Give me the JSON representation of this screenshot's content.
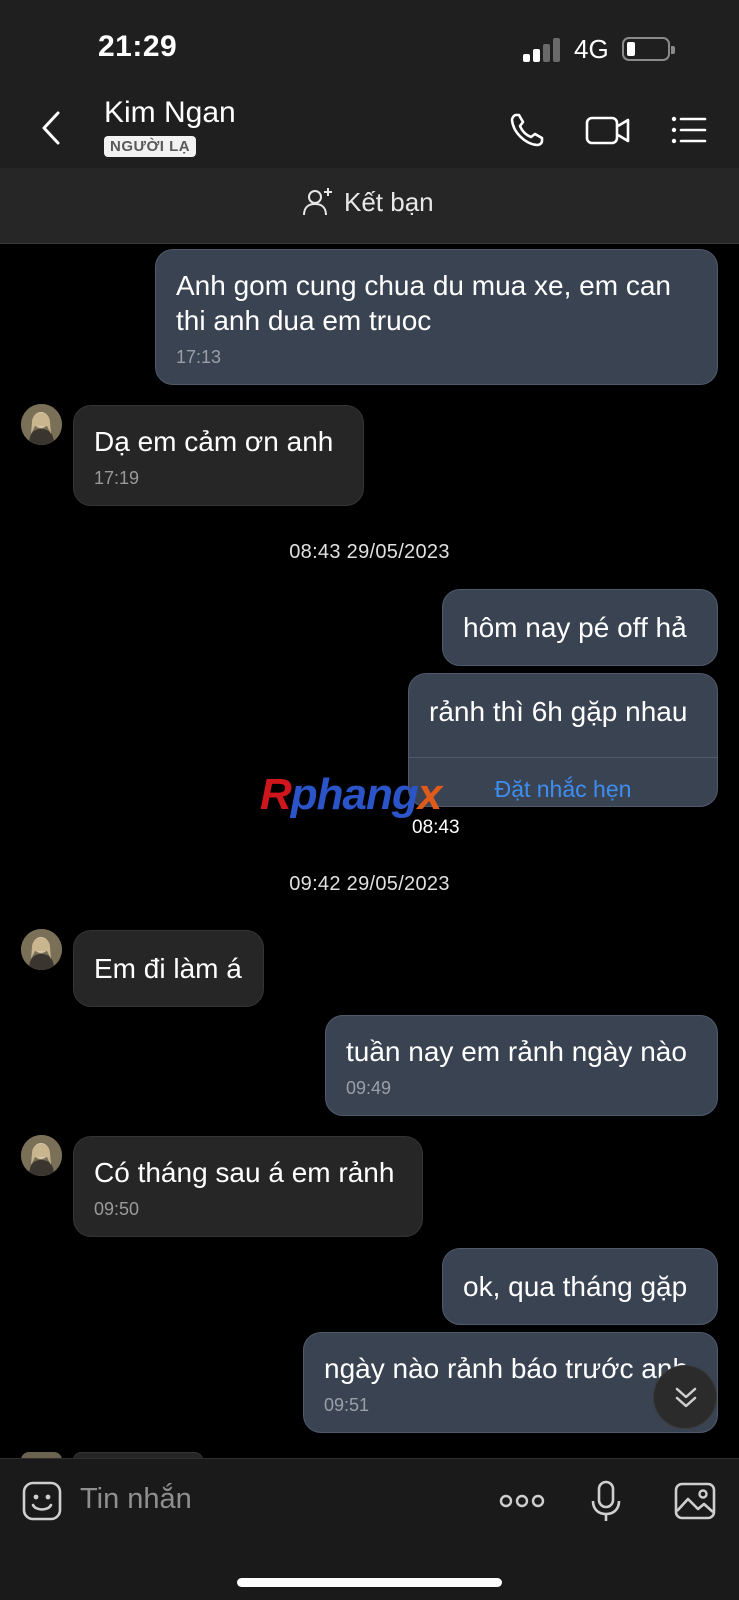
{
  "status_bar": {
    "time": "21:29",
    "network": "4G",
    "battery_level": 0.15
  },
  "header": {
    "contact_name": "Kim Ngan",
    "badge": "NGƯỜI LẠ",
    "icons": [
      "back-icon",
      "phone-icon",
      "video-call-icon",
      "menu-list-icon"
    ]
  },
  "add_friend": {
    "label": "Kết bạn",
    "icon": "add-user-icon"
  },
  "messages": [
    {
      "dir": "out",
      "text": "Anh gom cung chua du mua xe, em can thi anh dua em truoc",
      "time": "17:13"
    },
    {
      "dir": "in",
      "text": "Dạ em cảm ơn anh",
      "time": "17:19"
    },
    {
      "separator": "08:43 29/05/2023"
    },
    {
      "dir": "out",
      "text": "hôm nay pé off hả"
    },
    {
      "dir": "out",
      "text": "rảnh thì 6h gặp nhau",
      "action": "Đặt nhắc hẹn",
      "time": "08:43"
    },
    {
      "separator": "09:42 29/05/2023"
    },
    {
      "dir": "in",
      "text": "Em đi làm á"
    },
    {
      "dir": "out",
      "text": "tuần nay em rảnh ngày nào",
      "time": "09:49"
    },
    {
      "dir": "in",
      "text": "Có tháng sau á em rảnh",
      "time": "09:50"
    },
    {
      "dir": "out",
      "text": "ok, qua tháng gặp"
    },
    {
      "dir": "out",
      "text": "ngày nào rảnh báo trước anh",
      "time": "09:51"
    }
  ],
  "watermark": {
    "part1": "R",
    "part2": "phang",
    "part3": "x"
  },
  "composer": {
    "placeholder": "Tin nhắn",
    "icons": [
      "sticker-icon",
      "more-dots-icon",
      "microphone-icon",
      "image-icon"
    ]
  },
  "colors": {
    "outgoing_bubble": "#3a4352",
    "incoming_bubble": "#262626",
    "link": "#3d8ef0",
    "background": "#000000"
  }
}
